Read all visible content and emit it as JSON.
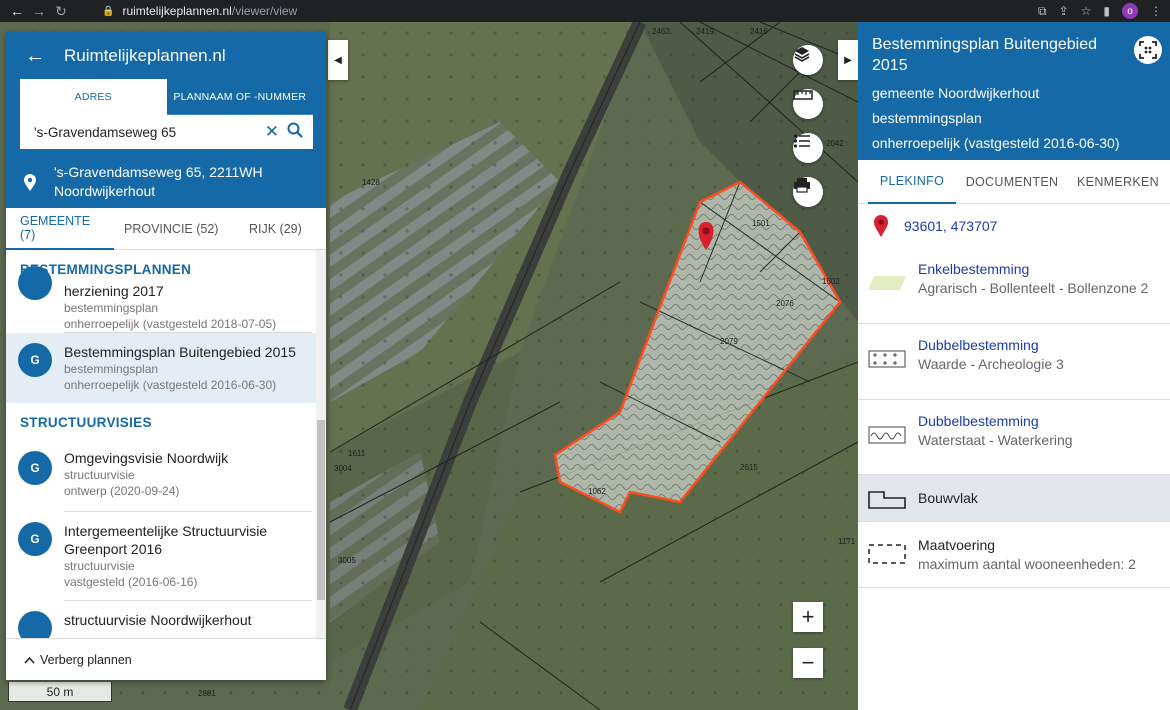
{
  "browser": {
    "url_domain": "ruimtelijkeplannen.nl",
    "url_path": "/viewer/view",
    "profile_initial": "o"
  },
  "left_panel": {
    "title": "Ruimtelijkeplannen.nl",
    "tabs": [
      "ADRES",
      "PLANNAAM OF -NUMMER"
    ],
    "search_value": "'s-Gravendamseweg 65",
    "address_line1": "'s-Gravendamseweg 65, 2211WH",
    "address_line2": "Noordwijkerhout",
    "subtabs": [
      "GEMEENTE (7)",
      "PROVINCIE (52)",
      "RIJK (29)"
    ],
    "section1": "BESTEMMINGSPLANNEN",
    "plan_partial": {
      "name": "herziening 2017",
      "type": "bestemmingsplan",
      "status": "onherroepelijk (vastgesteld 2018-07-05)"
    },
    "plan_selected": {
      "badge": "G",
      "name": "Bestemmingsplan Buitengebied 2015",
      "type": "bestemmingsplan",
      "status": "onherroepelijk (vastgesteld 2016-06-30)"
    },
    "section2": "STRUCTUURVISIES",
    "plan_visie1": {
      "badge": "G",
      "name": "Omgevingsvisie Noordwijk",
      "type": "structuurvisie",
      "status": "ontwerp (2020-09-24)"
    },
    "plan_visie2": {
      "badge": "G",
      "name1": "Intergemeentelijke Structuurvisie",
      "name2": "Greenport 2016",
      "type": "structuurvisie",
      "status": "vastgesteld (2016-06-16)"
    },
    "plan_visie3": {
      "name": "structuurvisie Noordwijkerhout"
    },
    "footer": "Verberg plannen"
  },
  "map": {
    "scale": "50 m",
    "parcel_labels": [
      "2462",
      "2419",
      "2416",
      "1428",
      "1501",
      "1502",
      "2076",
      "2079",
      "1611",
      "3004",
      "3005",
      "2615",
      "1062",
      "1171",
      "2881",
      "2042"
    ],
    "zoom_in": "+",
    "zoom_out": "−"
  },
  "right_panel": {
    "title": "Bestemmingsplan Buitengebied 2015",
    "municipality": "gemeente Noordwijkerhout",
    "type": "bestemmingsplan",
    "status": "onherroepelijk (vastgesteld 2016-06-30)",
    "tabs": [
      "PLEKINFO",
      "DOCUMENTEN",
      "KENMERKEN"
    ],
    "coords": "93601, 473707",
    "legend": [
      {
        "name": "Enkelbestemming",
        "value": "Agrarisch - Bollenteelt - Bollenzone 2",
        "color": "#e4ecc4"
      },
      {
        "name": "Dubbelbestemming",
        "value": "Waarde - Archeologie 3"
      },
      {
        "name": "Dubbelbestemming",
        "value": "Waterstaat - Waterkering"
      },
      {
        "name": "Bouwvlak",
        "value": ""
      },
      {
        "name": "Maatvoering",
        "value": "maximum aantal wooneenheden: 2"
      }
    ]
  },
  "colors": {
    "brand_blue": "#1569a7",
    "link_blue": "#1a3cb0",
    "plan_outline": "#ff4b1f",
    "marker_red": "#d9202e"
  }
}
